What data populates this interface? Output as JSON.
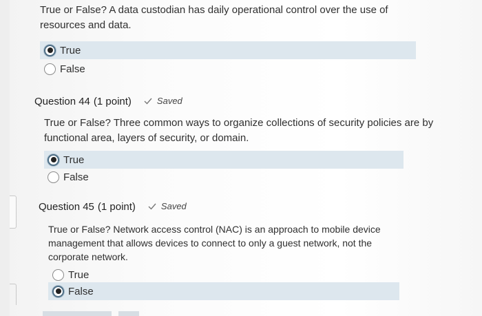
{
  "q43": {
    "text_line1": "True or False? A data custodian has daily operational control over the use of",
    "text_line2": "resources and data.",
    "options": [
      {
        "label": "True",
        "selected": true
      },
      {
        "label": "False",
        "selected": false
      }
    ]
  },
  "q44": {
    "number": "Question 44",
    "points": "(1 point)",
    "status": "Saved",
    "text_line1": "True or False? Three common ways to organize collections of security policies are by",
    "text_line2": "functional area, layers of security, or domain.",
    "options": [
      {
        "label": "True",
        "selected": true
      },
      {
        "label": "False",
        "selected": false
      }
    ]
  },
  "q45": {
    "number": "Question 45",
    "points": "(1 point)",
    "status": "Saved",
    "text_line1": "True or False? Network access control (NAC) is an approach to mobile device",
    "text_line2": "management that allows devices to connect to only a guest network, not the",
    "text_line3": "corporate network.",
    "options": [
      {
        "label": "True",
        "selected": false
      },
      {
        "label": "False",
        "selected": true
      }
    ]
  },
  "icons": {
    "saved": "checkmark-icon",
    "option": "radio-button-icon"
  },
  "colors": {
    "selected_row": "#dde7ee",
    "radio_ring": "#4f6f86"
  }
}
